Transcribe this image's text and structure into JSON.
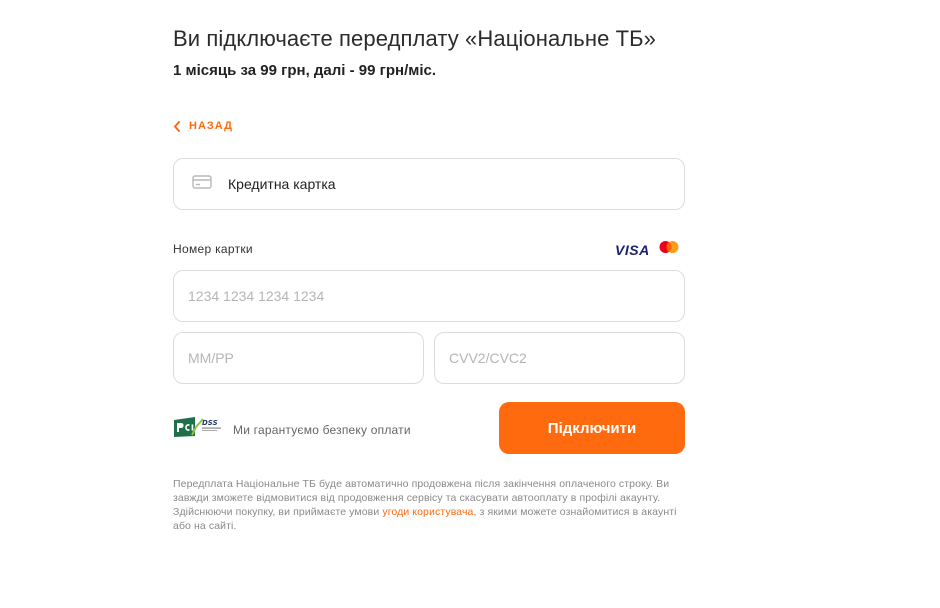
{
  "header": {
    "title": "Ви підключаєте передплату «Національне ТБ»",
    "subtitle": "1 місяць за 99 грн, далі - 99 грн/міс."
  },
  "back": {
    "label": "НАЗАД",
    "icon": "chevron-left-icon"
  },
  "payment_method": {
    "label": "Кредитна картка",
    "icon": "credit-card-icon"
  },
  "card_form": {
    "number_label": "Номер картки",
    "brands": {
      "visa": "VISA",
      "mastercard_icon": "mastercard-icon"
    },
    "number_placeholder": "1234 1234 1234 1234",
    "expiry_placeholder": "ММ/РР",
    "cvv_placeholder": "CVV2/CVC2"
  },
  "security": {
    "badge_icon": "pci-dss-badge-icon",
    "text": "Ми гарантуємо безпеку оплати"
  },
  "submit_label": "Підключити",
  "legal": {
    "text_before": "Передплата Національне ТБ буде автоматично продовжена після закінчення оплаченого строку. Ви завжди зможете відмовитися від продовження сервісу та скасувати автооплату в профілі акаунту. Здійснюючи покупку, ви приймаєте умови ",
    "link": "угоди користувача",
    "text_after": ", з якими можете ознайомитися в акаунті або на сайті."
  },
  "colors": {
    "accent": "#ff6a0e",
    "border": "#dcdcdc",
    "visa": "#1a1f71"
  }
}
